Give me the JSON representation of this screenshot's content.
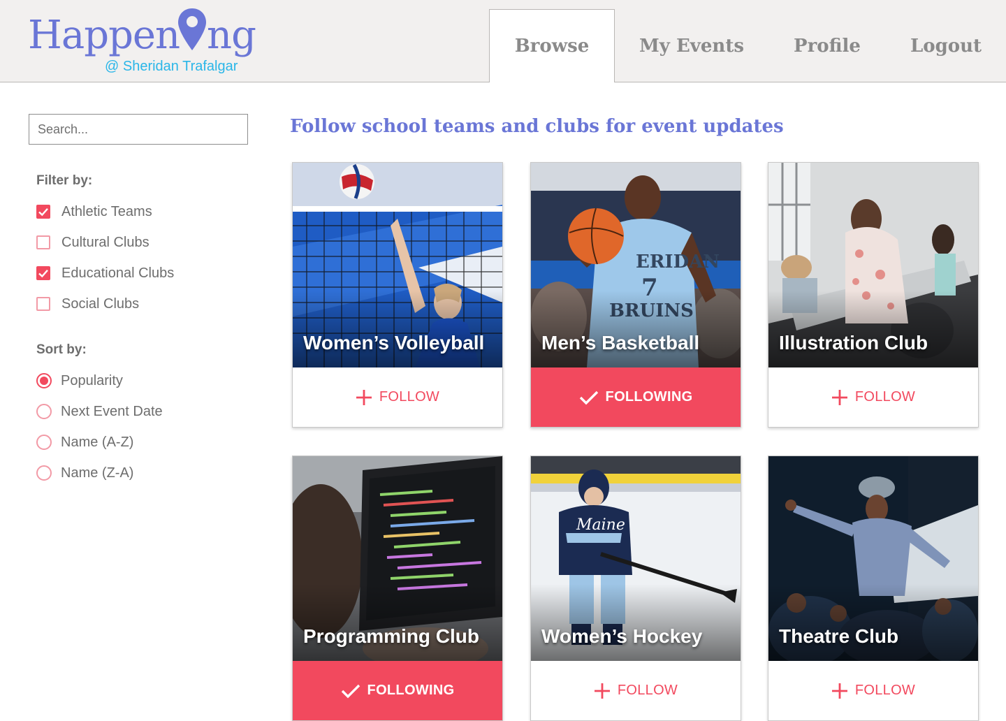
{
  "brand": {
    "name_left": "Happen",
    "name_right": "ng",
    "subtitle": "@ Sheridan Trafalgar",
    "color": "#6a76d6",
    "subtitle_color": "#2ab6e8",
    "pin_icon": "map-pin-icon"
  },
  "nav": {
    "tabs": [
      {
        "label": "Browse",
        "active": true
      },
      {
        "label": "My Events",
        "active": false
      },
      {
        "label": "Profile",
        "active": false
      },
      {
        "label": "Logout",
        "active": false
      }
    ]
  },
  "sidebar": {
    "search_placeholder": "Search...",
    "filter_label": "Filter by:",
    "filters": [
      {
        "label": "Athletic Teams",
        "checked": true
      },
      {
        "label": "Cultural Clubs",
        "checked": false
      },
      {
        "label": "Educational Clubs",
        "checked": true
      },
      {
        "label": "Social Clubs",
        "checked": false
      }
    ],
    "sort_label": "Sort by:",
    "sorts": [
      {
        "label": "Popularity",
        "selected": true
      },
      {
        "label": "Next Event Date",
        "selected": false
      },
      {
        "label": "Name (A-Z)",
        "selected": false
      },
      {
        "label": "Name (Z-A)",
        "selected": false
      }
    ]
  },
  "main": {
    "headline": "Follow school teams and clubs for event updates",
    "follow_label": "FOLLOW",
    "following_label": "FOLLOWING",
    "cards": [
      {
        "title": "Women’s Volleyball",
        "following": false
      },
      {
        "title": "Men’s Basketball",
        "following": true
      },
      {
        "title": "Illustration Club",
        "following": false
      },
      {
        "title": "Programming Club",
        "following": true
      },
      {
        "title": "Women’s Hockey",
        "following": false
      },
      {
        "title": "Theatre Club",
        "following": false
      }
    ]
  },
  "colors": {
    "accent": "#f2495e",
    "header_bg": "#f2f0ef",
    "text": "#6d6d6d"
  }
}
